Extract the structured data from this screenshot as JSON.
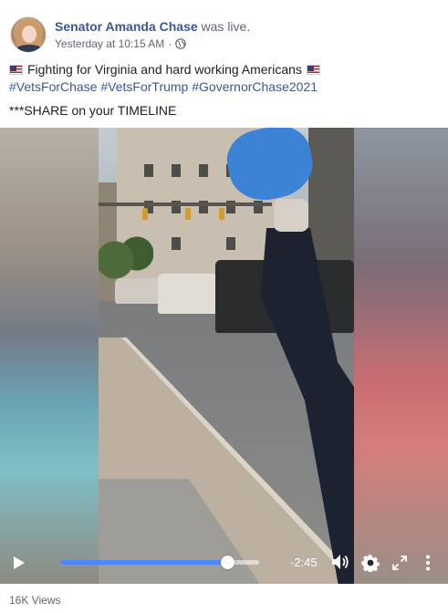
{
  "post": {
    "author": "Senator Amanda Chase",
    "action": "was live.",
    "timestamp": "Yesterday at 10:15 AM",
    "separator": "·",
    "privacy_icon": "globe-icon",
    "line1_text": "Fighting for Virginia and hard working Americans",
    "flag_icon": "us-flag-icon",
    "hashtags": [
      "#VetsForChase",
      "#VetsForTrump",
      "#GovernorChase2021"
    ],
    "line3_text": "***SHARE on your TIMELINE"
  },
  "video": {
    "progress": 0.84,
    "time_remaining": "-2:45",
    "accent_color": "#4f86f7",
    "icons": [
      "play-icon",
      "volume-icon",
      "settings-gear-icon",
      "fullscreen-expand-icon",
      "more-options-icon"
    ]
  },
  "footer": {
    "views": "16K Views"
  },
  "colors": {
    "link": "#385898",
    "text": "#1c1e21",
    "meta": "#606770"
  }
}
